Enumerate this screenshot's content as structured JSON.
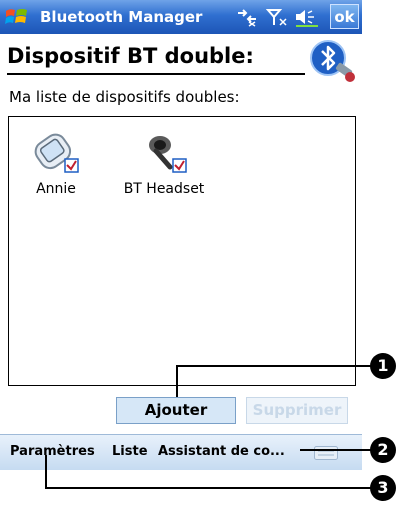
{
  "titlebar": {
    "app_title": "Bluetooth Manager",
    "ok_label": "ok",
    "icons": [
      "windows-start-icon",
      "connectivity-icon",
      "signal-icon",
      "volume-icon"
    ]
  },
  "header": {
    "title": "Dispositif BT double:",
    "logo_icon": "bluetooth-logo-icon"
  },
  "subtitle": "Ma liste de dispositifs doubles:",
  "devices": [
    {
      "label": "Annie",
      "icon": "pda-device-icon",
      "checked": true
    },
    {
      "label": "BT Headset",
      "icon": "headset-icon",
      "checked": true
    }
  ],
  "buttons": {
    "add_label": "Ajouter",
    "delete_label": "Supprimer"
  },
  "menubar": {
    "items": [
      "Paramètres",
      "Liste",
      "Assistant de co..."
    ],
    "keyboard_icon": "keyboard-icon"
  },
  "callouts": [
    "1",
    "2",
    "3"
  ],
  "colors": {
    "titlebar": "#2f6fd0",
    "menubar": "#c6dbf1",
    "button_fill": "#d6e7f7"
  }
}
